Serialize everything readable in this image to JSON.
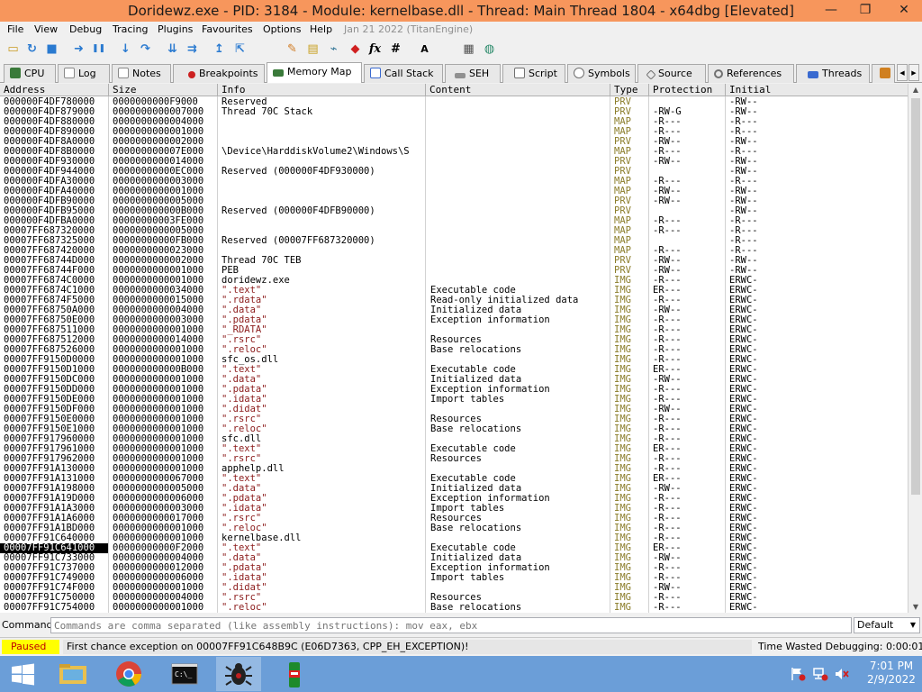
{
  "window": {
    "title": "Doridewz.exe - PID: 3184 - Module: kernelbase.dll - Thread: Main Thread 1804 - x64dbg [Elevated]",
    "minimize_glyph": "—",
    "restore_glyph": "❐",
    "close_glyph": "✕"
  },
  "menu": {
    "items": [
      "File",
      "View",
      "Debug",
      "Tracing",
      "Plugins",
      "Favourites",
      "Options",
      "Help"
    ],
    "build_date": "Jan 21 2022 (TitanEngine)"
  },
  "toolbar": {
    "icons": [
      "open-icon",
      "restart-icon",
      "stop-icon",
      "run-icon",
      "pause-icon",
      "step-into-icon",
      "step-over-icon",
      "trace-into-icon",
      "trace-over-icon",
      "execute-till-return-icon",
      "run-to-user-code-icon",
      "patch-icon",
      "comments-icon",
      "labels-icon",
      "bookmarks-icon",
      "functions-icon",
      "hash-icon",
      "font-icon",
      "calculator-icon",
      "globe-icon"
    ],
    "glyphs": [
      "▭",
      "↻",
      "■",
      "➜",
      "❚❚",
      "↓",
      "↷",
      "⇊",
      "⇉",
      "↥",
      "⇱",
      "✎",
      "▤",
      "⌁",
      "◆",
      "fx",
      "#",
      "A",
      "▦",
      "◍"
    ]
  },
  "tabs": [
    {
      "label": "CPU",
      "icon": "cpu-icon",
      "color": "#3a7a3a"
    },
    {
      "label": "Log",
      "icon": "log-icon",
      "color": "#8a8a8a"
    },
    {
      "label": "Notes",
      "icon": "notes-icon",
      "color": "#8a8a8a"
    },
    {
      "label": "Breakpoints",
      "icon": "breakpoint-icon",
      "color": "#cc2020"
    },
    {
      "label": "Memory Map",
      "icon": "memory-icon",
      "color": "#3a7a3a"
    },
    {
      "label": "Call Stack",
      "icon": "callstack-icon",
      "color": "#3a6ad0"
    },
    {
      "label": "SEH",
      "icon": "seh-icon",
      "color": "#707070"
    },
    {
      "label": "Script",
      "icon": "script-icon",
      "color": "#707070"
    },
    {
      "label": "Symbols",
      "icon": "symbols-icon",
      "color": "#707070"
    },
    {
      "label": "Source",
      "icon": "source-icon",
      "color": "#707070"
    },
    {
      "label": "References",
      "icon": "references-icon",
      "color": "#707070"
    },
    {
      "label": "Threads",
      "icon": "threads-icon",
      "color": "#3a6ad0"
    }
  ],
  "table": {
    "columns": [
      "Address",
      "Size",
      "Info",
      "Content",
      "Type",
      "Protection",
      "Initial"
    ],
    "rows": [
      [
        "000000F4DF780000",
        "0000000000F9000",
        "Reserved",
        "",
        "PRV",
        "",
        "-RW--"
      ],
      [
        "000000F4DF879000",
        "0000000000007000",
        "Thread 70C Stack",
        "",
        "PRV",
        "-RW-G",
        "-RW--"
      ],
      [
        "000000F4DF880000",
        "0000000000004000",
        "",
        "",
        "MAP",
        "-R---",
        "-R---"
      ],
      [
        "000000F4DF890000",
        "0000000000001000",
        "",
        "",
        "MAP",
        "-R---",
        "-R---"
      ],
      [
        "000000F4DF8A0000",
        "0000000000002000",
        "",
        "",
        "PRV",
        "-RW--",
        "-RW--"
      ],
      [
        "000000F4DF8B0000",
        "000000000007E000",
        "\\Device\\HarddiskVolume2\\Windows\\S",
        "",
        "MAP",
        "-R---",
        "-R---"
      ],
      [
        "000000F4DF930000",
        "0000000000014000",
        "",
        "",
        "PRV",
        "-RW--",
        "-RW--"
      ],
      [
        "000000F4DF944000",
        "00000000000EC000",
        "Reserved (000000F4DF930000)",
        "",
        "PRV",
        "",
        "-RW--"
      ],
      [
        "000000F4DFA30000",
        "0000000000003000",
        "",
        "",
        "MAP",
        "-R---",
        "-R---"
      ],
      [
        "000000F4DFA40000",
        "0000000000001000",
        "",
        "",
        "MAP",
        "-RW--",
        "-RW--"
      ],
      [
        "000000F4DFB90000",
        "0000000000005000",
        "",
        "",
        "PRV",
        "-RW--",
        "-RW--"
      ],
      [
        "000000F4DFB95000",
        "000000000000B000",
        "Reserved (000000F4DFB90000)",
        "",
        "PRV",
        "",
        "-RW--"
      ],
      [
        "000000F4DFBA0000",
        "00000000003FE000",
        "",
        "",
        "MAP",
        "-R---",
        "-R---"
      ],
      [
        "00007FF687320000",
        "0000000000005000",
        "",
        "",
        "MAP",
        "-R---",
        "-R---"
      ],
      [
        "00007FF687325000",
        "00000000000FB000",
        "Reserved (00007FF687320000)",
        "",
        "MAP",
        "",
        "-R---"
      ],
      [
        "00007FF687420000",
        "0000000000023000",
        "",
        "",
        "MAP",
        "-R---",
        "-R---"
      ],
      [
        "00007FF68744D000",
        "0000000000002000",
        "Thread 70C TEB",
        "",
        "PRV",
        "-RW--",
        "-RW--"
      ],
      [
        "00007FF68744F000",
        "0000000000001000",
        "PEB",
        "",
        "PRV",
        "-RW--",
        "-RW--"
      ],
      [
        "00007FF6874C0000",
        "0000000000001000",
        "doridewz.exe",
        "",
        "IMG",
        "-R---",
        "ERWC-"
      ],
      [
        "00007FF6874C1000",
        "0000000000034000",
        "\".text\"",
        "Executable code",
        "IMG",
        "ER---",
        "ERWC-"
      ],
      [
        "00007FF6874F5000",
        "0000000000015000",
        "\".rdata\"",
        "Read-only initialized data",
        "IMG",
        "-R---",
        "ERWC-"
      ],
      [
        "00007FF68750A000",
        "0000000000004000",
        "\".data\"",
        "Initialized data",
        "IMG",
        "-RW--",
        "ERWC-"
      ],
      [
        "00007FF68750E000",
        "0000000000003000",
        "\".pdata\"",
        "Exception information",
        "IMG",
        "-R---",
        "ERWC-"
      ],
      [
        "00007FF687511000",
        "0000000000001000",
        "\"_RDATA\"",
        "",
        "IMG",
        "-R---",
        "ERWC-"
      ],
      [
        "00007FF687512000",
        "0000000000014000",
        "\".rsrc\"",
        "Resources",
        "IMG",
        "-R---",
        "ERWC-"
      ],
      [
        "00007FF687526000",
        "0000000000001000",
        "\".reloc\"",
        "Base relocations",
        "IMG",
        "-R---",
        "ERWC-"
      ],
      [
        "00007FF9150D0000",
        "0000000000001000",
        "sfc_os.dll",
        "",
        "IMG",
        "-R---",
        "ERWC-"
      ],
      [
        "00007FF9150D1000",
        "000000000000B000",
        "\".text\"",
        "Executable code",
        "IMG",
        "ER---",
        "ERWC-"
      ],
      [
        "00007FF9150DC000",
        "0000000000001000",
        "\".data\"",
        "Initialized data",
        "IMG",
        "-RW--",
        "ERWC-"
      ],
      [
        "00007FF9150DD000",
        "0000000000001000",
        "\".pdata\"",
        "Exception information",
        "IMG",
        "-R---",
        "ERWC-"
      ],
      [
        "00007FF9150DE000",
        "0000000000001000",
        "\".idata\"",
        "Import tables",
        "IMG",
        "-R---",
        "ERWC-"
      ],
      [
        "00007FF9150DF000",
        "0000000000001000",
        "\".didat\"",
        "",
        "IMG",
        "-RW--",
        "ERWC-"
      ],
      [
        "00007FF9150E0000",
        "0000000000001000",
        "\".rsrc\"",
        "Resources",
        "IMG",
        "-R---",
        "ERWC-"
      ],
      [
        "00007FF9150E1000",
        "0000000000001000",
        "\".reloc\"",
        "Base relocations",
        "IMG",
        "-R---",
        "ERWC-"
      ],
      [
        "00007FF917960000",
        "0000000000001000",
        "sfc.dll",
        "",
        "IMG",
        "-R---",
        "ERWC-"
      ],
      [
        "00007FF917961000",
        "0000000000001000",
        "\".text\"",
        "Executable code",
        "IMG",
        "ER---",
        "ERWC-"
      ],
      [
        "00007FF917962000",
        "0000000000001000",
        "\".rsrc\"",
        "Resources",
        "IMG",
        "-R---",
        "ERWC-"
      ],
      [
        "00007FF91A130000",
        "0000000000001000",
        "apphelp.dll",
        "",
        "IMG",
        "-R---",
        "ERWC-"
      ],
      [
        "00007FF91A131000",
        "0000000000067000",
        "\".text\"",
        "Executable code",
        "IMG",
        "ER---",
        "ERWC-"
      ],
      [
        "00007FF91A198000",
        "0000000000005000",
        "\".data\"",
        "Initialized data",
        "IMG",
        "-RW--",
        "ERWC-"
      ],
      [
        "00007FF91A19D000",
        "0000000000006000",
        "\".pdata\"",
        "Exception information",
        "IMG",
        "-R---",
        "ERWC-"
      ],
      [
        "00007FF91A1A3000",
        "0000000000003000",
        "\".idata\"",
        "Import tables",
        "IMG",
        "-R---",
        "ERWC-"
      ],
      [
        "00007FF91A1A6000",
        "0000000000017000",
        "\".rsrc\"",
        "Resources",
        "IMG",
        "-R---",
        "ERWC-"
      ],
      [
        "00007FF91A1BD000",
        "0000000000001000",
        "\".reloc\"",
        "Base relocations",
        "IMG",
        "-R---",
        "ERWC-"
      ],
      [
        "00007FF91C640000",
        "0000000000001000",
        "kernelbase.dll",
        "",
        "IMG",
        "-R---",
        "ERWC-"
      ],
      [
        "00007FF91C641000",
        "00000000000F2000",
        "\".text\"",
        "Executable code",
        "IMG",
        "ER---",
        "ERWC-"
      ],
      [
        "00007FF91C733000",
        "0000000000004000",
        "\".data\"",
        "Initialized data",
        "IMG",
        "-RW--",
        "ERWC-"
      ],
      [
        "00007FF91C737000",
        "0000000000012000",
        "\".pdata\"",
        "Exception information",
        "IMG",
        "-R---",
        "ERWC-"
      ],
      [
        "00007FF91C749000",
        "0000000000006000",
        "\".idata\"",
        "Import tables",
        "IMG",
        "-R---",
        "ERWC-"
      ],
      [
        "00007FF91C74F000",
        "0000000000001000",
        "\".didat\"",
        "",
        "IMG",
        "-RW--",
        "ERWC-"
      ],
      [
        "00007FF91C750000",
        "0000000000004000",
        "\".rsrc\"",
        "Resources",
        "IMG",
        "-R---",
        "ERWC-"
      ],
      [
        "00007FF91C754000",
        "0000000000001000",
        "\".reloc\"",
        "Base relocations",
        "IMG",
        "-R---",
        "ERWC-"
      ]
    ],
    "selected_address": "00007FF91C641000"
  },
  "command": {
    "label": "Command:",
    "placeholder": "Commands are comma separated (like assembly instructions): mov eax, ebx",
    "mode": "Default"
  },
  "status": {
    "state": "Paused",
    "message": "First chance exception on 00007FF91C648B9C (E06D7363, CPP_EH_EXCEPTION)!",
    "time_wasted": "Time Wasted Debugging: 0:00:01:12"
  },
  "taskbar": {
    "apps": [
      "windows-start-icon",
      "file-explorer-icon",
      "chrome-icon",
      "cmd-icon",
      "x64dbg-icon",
      "mountain-dew-icon"
    ],
    "time": "7:01 PM",
    "date": "2/9/2022"
  },
  "colors": {
    "title_bg": "#f7965c",
    "type_text": "#8b7d2a",
    "section_text": "#8b1a1a",
    "paused_bg": "#ffff00",
    "paused_text": "#c00000",
    "taskbar_bg": "#6b9ed8"
  }
}
